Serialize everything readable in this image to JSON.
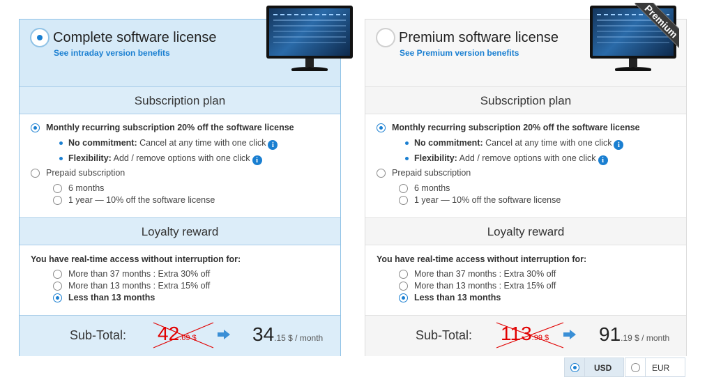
{
  "cards": [
    {
      "title": "Complete software license",
      "link": "See intraday version benefits",
      "selected": true,
      "ribbon": "",
      "subscription_title": "Subscription plan",
      "monthly_label": "Monthly recurring subscription 20% off the software license",
      "no_commitment_label": "No commitment:",
      "no_commitment_text": "Cancel at any time with one click",
      "flexibility_label": "Flexibility:",
      "flexibility_text": "Add / remove options with one click",
      "prepaid_label": "Prepaid subscription",
      "six_months": "6 months",
      "one_year": "1 year — 10% off the software license",
      "loyalty_title": "Loyalty reward",
      "loyalty_intro": "You have real-time access without interruption for:",
      "loyalty_opt1": "More than 37 months : Extra 30% off",
      "loyalty_opt2": "More than 13 months : Extra 15% off",
      "loyalty_opt3": "Less than 13 months",
      "subtotal_label": "Sub-Total:",
      "old_price_int": "42",
      "old_price_dec": ".69 $",
      "new_price_int": "34",
      "new_price_dec": ".15 $ / month"
    },
    {
      "title": "Premium software license",
      "link": "See Premium version benefits",
      "selected": false,
      "ribbon": "Premium",
      "subscription_title": "Subscription plan",
      "monthly_label": "Monthly recurring subscription 20% off the software license",
      "no_commitment_label": "No commitment:",
      "no_commitment_text": "Cancel at any time with one click",
      "flexibility_label": "Flexibility:",
      "flexibility_text": "Add / remove options with one click",
      "prepaid_label": "Prepaid subscription",
      "six_months": "6 months",
      "one_year": "1 year — 10% off the software license",
      "loyalty_title": "Loyalty reward",
      "loyalty_intro": "You have real-time access without interruption for:",
      "loyalty_opt1": "More than 37 months : Extra 30% off",
      "loyalty_opt2": "More than 13 months : Extra 15% off",
      "loyalty_opt3": "Less than 13 months",
      "subtotal_label": "Sub-Total:",
      "old_price_int": "113",
      "old_price_dec": ".99 $",
      "new_price_int": "91",
      "new_price_dec": ".19 $ / month"
    }
  ],
  "currency": {
    "usd": "USD",
    "eur": "EUR",
    "selected": "USD"
  },
  "icons": {
    "info": "i"
  },
  "colors": {
    "accent": "#1a7fd1",
    "strike": "#e10000",
    "selected_card_bg": "#dcedf9"
  }
}
